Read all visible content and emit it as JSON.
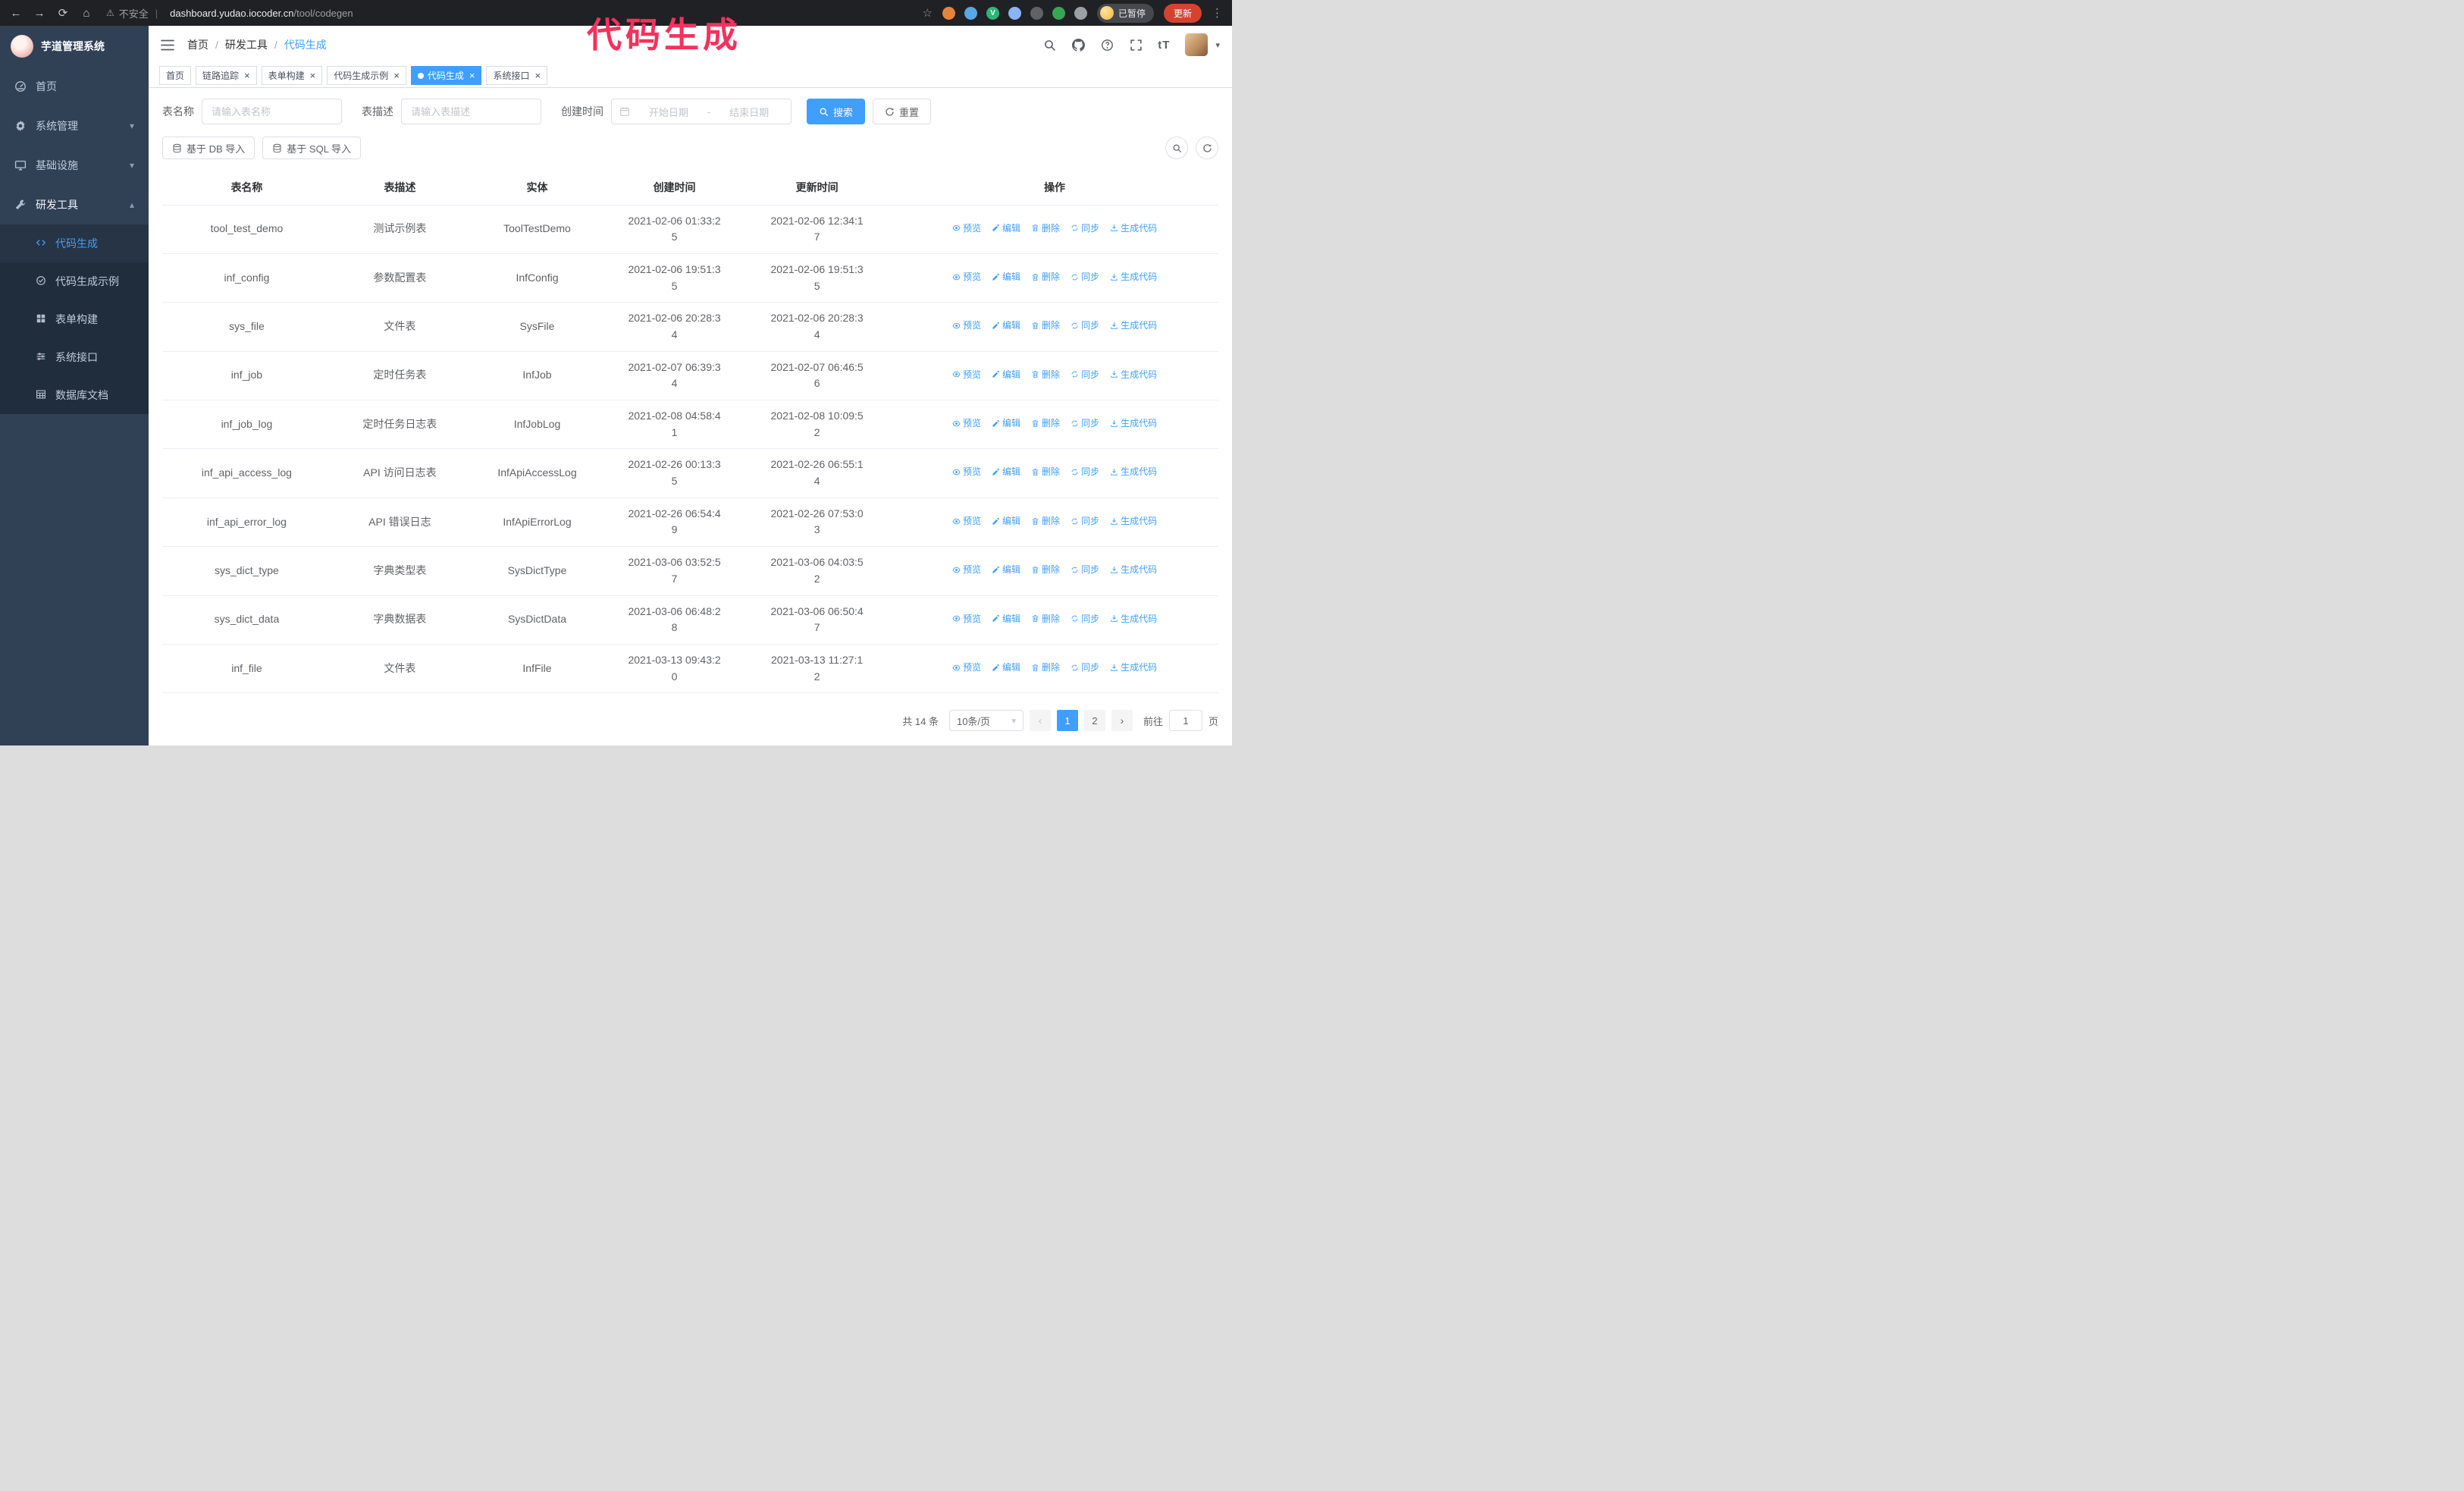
{
  "colors": {
    "primary": "#409EFF",
    "annotation": "#F5315D",
    "sidebar_bg": "#304156",
    "submenu_bg": "#1F2D3D",
    "browser_bar_bg": "#202124"
  },
  "annotation": {
    "text": "代码生成"
  },
  "browser": {
    "security_label": "不安全",
    "url_host": "dashboard.yudao.iocoder.cn",
    "url_path": "/tool/codegen",
    "profile_badge": "已暂停",
    "update_button": "更新",
    "extensions": [
      {
        "color": "#E8833A",
        "glyph": ""
      },
      {
        "color": "#58A6E8",
        "glyph": ""
      },
      {
        "color": "#2BB673",
        "glyph": "V"
      },
      {
        "color": "#8AB4F8",
        "glyph": ""
      },
      {
        "color": "#5F6368",
        "glyph": ""
      },
      {
        "color": "#34A853",
        "glyph": ""
      },
      {
        "color": "#9AA0A6",
        "glyph": ""
      }
    ]
  },
  "sidebar": {
    "logo_title": "芋道管理系统",
    "items": [
      {
        "id": "home",
        "label": "首页",
        "icon": "dashboard-icon"
      },
      {
        "id": "system",
        "label": "系统管理",
        "icon": "gear-icon",
        "chevron": "down"
      },
      {
        "id": "infra",
        "label": "基础设施",
        "icon": "monitor-icon",
        "chevron": "down"
      },
      {
        "id": "dev-tools",
        "label": "研发工具",
        "icon": "tools-icon",
        "chevron": "up",
        "expanded": true
      }
    ],
    "sub_items": [
      {
        "id": "codegen",
        "label": "代码生成",
        "icon": "code-icon",
        "active": true
      },
      {
        "id": "codegen-example",
        "label": "代码生成示例",
        "icon": "badge-check-icon"
      },
      {
        "id": "form-builder",
        "label": "表单构建",
        "icon": "form-grid-icon"
      },
      {
        "id": "system-api",
        "label": "系统接口",
        "icon": "sliders-icon"
      },
      {
        "id": "db-doc",
        "label": "数据库文档",
        "icon": "table-grid-icon"
      }
    ]
  },
  "navbar": {
    "breadcrumb": [
      "首页",
      "研发工具",
      "代码生成"
    ]
  },
  "tabs": [
    {
      "label": "首页",
      "closable": false
    },
    {
      "label": "链路追踪",
      "closable": true
    },
    {
      "label": "表单构建",
      "closable": true
    },
    {
      "label": "代码生成示例",
      "closable": true
    },
    {
      "label": "代码生成",
      "closable": true,
      "active": true
    },
    {
      "label": "系统接口",
      "closable": true
    }
  ],
  "filters": {
    "table_name_label": "表名称",
    "table_name_placeholder": "请输入表名称",
    "table_desc_label": "表描述",
    "table_desc_placeholder": "请输入表描述",
    "create_time_label": "创建时间",
    "start_date_placeholder": "开始日期",
    "range_separator": "-",
    "end_date_placeholder": "结束日期",
    "search_button": "搜索",
    "reset_button": "重置"
  },
  "toolbar": {
    "import_db_button": "基于 DB 导入",
    "import_sql_button": "基于 SQL 导入"
  },
  "table": {
    "columns": [
      "表名称",
      "表描述",
      "实体",
      "创建时间",
      "更新时间",
      "操作"
    ],
    "actions": [
      {
        "id": "preview",
        "label": "预览",
        "icon": "eye-icon"
      },
      {
        "id": "edit",
        "label": "编辑",
        "icon": "edit-icon"
      },
      {
        "id": "delete",
        "label": "删除",
        "icon": "delete-icon"
      },
      {
        "id": "sync",
        "label": "同步",
        "icon": "sync-icon"
      },
      {
        "id": "generate",
        "label": "生成代码",
        "icon": "download-icon"
      }
    ],
    "rows": [
      {
        "name": "tool_test_demo",
        "desc": "测试示例表",
        "entity": "ToolTestDemo",
        "created": "2021-02-06 01:33:25",
        "updated": "2021-02-06 12:34:17"
      },
      {
        "name": "inf_config",
        "desc": "参数配置表",
        "entity": "InfConfig",
        "created": "2021-02-06 19:51:35",
        "updated": "2021-02-06 19:51:35"
      },
      {
        "name": "sys_file",
        "desc": "文件表",
        "entity": "SysFile",
        "created": "2021-02-06 20:28:34",
        "updated": "2021-02-06 20:28:34"
      },
      {
        "name": "inf_job",
        "desc": "定时任务表",
        "entity": "InfJob",
        "created": "2021-02-07 06:39:34",
        "updated": "2021-02-07 06:46:56"
      },
      {
        "name": "inf_job_log",
        "desc": "定时任务日志表",
        "entity": "InfJobLog",
        "created": "2021-02-08 04:58:41",
        "updated": "2021-02-08 10:09:52"
      },
      {
        "name": "inf_api_access_log",
        "desc": "API 访问日志表",
        "entity": "InfApiAccessLog",
        "created": "2021-02-26 00:13:35",
        "updated": "2021-02-26 06:55:14"
      },
      {
        "name": "inf_api_error_log",
        "desc": "API 错误日志",
        "entity": "InfApiErrorLog",
        "created": "2021-02-26 06:54:49",
        "updated": "2021-02-26 07:53:03"
      },
      {
        "name": "sys_dict_type",
        "desc": "字典类型表",
        "entity": "SysDictType",
        "created": "2021-03-06 03:52:57",
        "updated": "2021-03-06 04:03:52"
      },
      {
        "name": "sys_dict_data",
        "desc": "字典数据表",
        "entity": "SysDictData",
        "created": "2021-03-06 06:48:28",
        "updated": "2021-03-06 06:50:47"
      },
      {
        "name": "inf_file",
        "desc": "文件表",
        "entity": "InfFile",
        "created": "2021-03-13 09:43:20",
        "updated": "2021-03-13 11:27:12"
      }
    ]
  },
  "pagination": {
    "total_label": "共 14 条",
    "page_size_label": "10条/页",
    "pages": [
      "1",
      "2"
    ],
    "active_page": "1",
    "goto_label": "前往",
    "goto_value": "1",
    "goto_unit": "页"
  }
}
